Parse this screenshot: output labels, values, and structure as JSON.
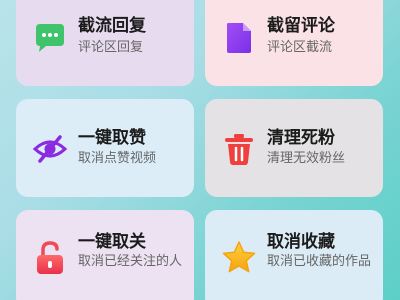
{
  "cards": [
    {
      "title": "截流回复",
      "subtitle": "评论区回复",
      "icon": "chat-bubble-icon",
      "color": "#3fc36b"
    },
    {
      "title": "截留评论",
      "subtitle": "评论区截流",
      "icon": "document-icon",
      "color": "#8b3ef2"
    },
    {
      "title": "一键取赞",
      "subtitle": "取消点赞视频",
      "icon": "eye-off-icon",
      "color": "#8a2be2"
    },
    {
      "title": "清理死粉",
      "subtitle": "清理无效粉丝",
      "icon": "trash-icon",
      "color": "#f0403e"
    },
    {
      "title": "一键取关",
      "subtitle": "取消已经关注的人",
      "icon": "unlock-icon",
      "color": "#f04a55"
    },
    {
      "title": "取消收藏",
      "subtitle": "取消已收藏的作品",
      "icon": "star-icon",
      "color": "#f7b81d"
    }
  ]
}
